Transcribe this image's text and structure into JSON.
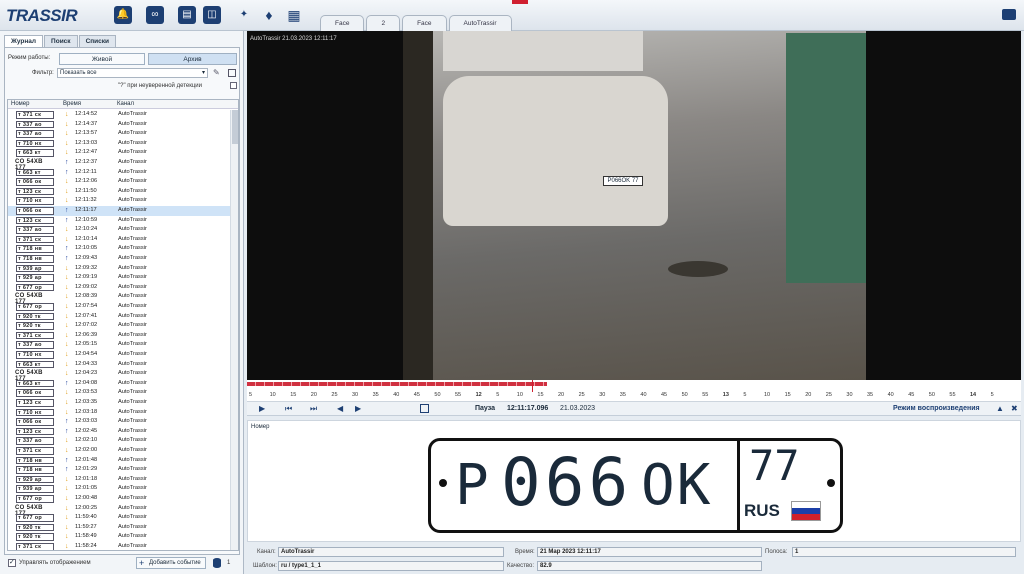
{
  "app": {
    "logo": "TRASSIR"
  },
  "top_tabs": [
    "Face",
    "2",
    "Face",
    "AutoTrassir"
  ],
  "left_panel": {
    "tabs": [
      "Журнал",
      "Поиск",
      "Списки"
    ],
    "mode_label": "Режим работы:",
    "mode_live": "Живой",
    "mode_archive": "Архив",
    "filter_label": "Фильтр:",
    "filter_value": "Показать все",
    "wildcard_label": "\"?\" при неуверенной детекции",
    "columns": [
      "Номер",
      "Время",
      "Канал"
    ],
    "rows": [
      {
        "plate": "т 371 ск",
        "dir": "down",
        "time": "12:14:52",
        "channel": "AutoTrassir"
      },
      {
        "plate": "т 337 ао",
        "dir": "down",
        "time": "12:14:37",
        "channel": "AutoTrassir"
      },
      {
        "plate": "т 337 ао",
        "dir": "down",
        "time": "12:13:57",
        "channel": "AutoTrassir"
      },
      {
        "plate": "т 710 нх",
        "dir": "down",
        "time": "12:13:03",
        "channel": "AutoTrassir"
      },
      {
        "plate": "т 663 кт",
        "dir": "down",
        "time": "12:12:47",
        "channel": "AutoTrassir"
      },
      {
        "plate": "CO 54XB 177",
        "dir": "up",
        "time": "12:12:37",
        "channel": "AutoTrassir",
        "bare": true
      },
      {
        "plate": "т 663 кт",
        "dir": "up",
        "time": "12:12:11",
        "channel": "AutoTrassir"
      },
      {
        "plate": "т 066 ок",
        "dir": "down",
        "time": "12:12:06",
        "channel": "AutoTrassir"
      },
      {
        "plate": "т 123 ск",
        "dir": "down",
        "time": "12:11:50",
        "channel": "AutoTrassir"
      },
      {
        "plate": "т 710 нх",
        "dir": "down",
        "time": "12:11:32",
        "channel": "AutoTrassir"
      },
      {
        "plate": "т 066 ок",
        "dir": "up",
        "time": "12:11:17",
        "channel": "AutoTrassir",
        "selected": true
      },
      {
        "plate": "т 123 ск",
        "dir": "up",
        "time": "12:10:59",
        "channel": "AutoTrassir"
      },
      {
        "plate": "т 337 ао",
        "dir": "down",
        "time": "12:10:24",
        "channel": "AutoTrassir"
      },
      {
        "plate": "т 371 ск",
        "dir": "down",
        "time": "12:10:14",
        "channel": "AutoTrassir"
      },
      {
        "plate": "т 718 нв",
        "dir": "up",
        "time": "12:10:05",
        "channel": "AutoTrassir"
      },
      {
        "plate": "т 718 нв",
        "dir": "up",
        "time": "12:09:43",
        "channel": "AutoTrassir"
      },
      {
        "plate": "т 939 ар",
        "dir": "down",
        "time": "12:09:32",
        "channel": "AutoTrassir"
      },
      {
        "plate": "т 929 ар",
        "dir": "down",
        "time": "12:09:19",
        "channel": "AutoTrassir"
      },
      {
        "plate": "т 677 ор",
        "dir": "down",
        "time": "12:09:02",
        "channel": "AutoTrassir"
      },
      {
        "plate": "CO 54XB 177",
        "dir": "down",
        "time": "12:08:39",
        "channel": "AutoTrassir",
        "bare": true
      },
      {
        "plate": "т 677 ор",
        "dir": "down",
        "time": "12:07:54",
        "channel": "AutoTrassir"
      },
      {
        "plate": "т 920 тк",
        "dir": "down",
        "time": "12:07:41",
        "channel": "AutoTrassir"
      },
      {
        "plate": "т 920 тк",
        "dir": "down",
        "time": "12:07:02",
        "channel": "AutoTrassir"
      },
      {
        "plate": "т 371 ск",
        "dir": "down",
        "time": "12:06:39",
        "channel": "AutoTrassir"
      },
      {
        "plate": "т 337 ао",
        "dir": "down",
        "time": "12:05:15",
        "channel": "AutoTrassir"
      },
      {
        "plate": "т 710 нх",
        "dir": "down",
        "time": "12:04:54",
        "channel": "AutoTrassir"
      },
      {
        "plate": "т 663 кт",
        "dir": "down",
        "time": "12:04:33",
        "channel": "AutoTrassir"
      },
      {
        "plate": "CO 54XB 177",
        "dir": "down",
        "time": "12:04:23",
        "channel": "AutoTrassir",
        "bare": true
      },
      {
        "plate": "т 663 кт",
        "dir": "up",
        "time": "12:04:08",
        "channel": "AutoTrassir"
      },
      {
        "plate": "т 066 ок",
        "dir": "down",
        "time": "12:03:53",
        "channel": "AutoTrassir"
      },
      {
        "plate": "т 123 ск",
        "dir": "down",
        "time": "12:03:35",
        "channel": "AutoTrassir"
      },
      {
        "plate": "т 710 нх",
        "dir": "down",
        "time": "12:03:18",
        "channel": "AutoTrassir"
      },
      {
        "plate": "т 066 ок",
        "dir": "up",
        "time": "12:03:03",
        "channel": "AutoTrassir"
      },
      {
        "plate": "т 123 ск",
        "dir": "up",
        "time": "12:02:45",
        "channel": "AutoTrassir"
      },
      {
        "plate": "т 337 ао",
        "dir": "down",
        "time": "12:02:10",
        "channel": "AutoTrassir"
      },
      {
        "plate": "т 371 ск",
        "dir": "down",
        "time": "12:02:00",
        "channel": "AutoTrassir"
      },
      {
        "plate": "т 718 нв",
        "dir": "up",
        "time": "12:01:48",
        "channel": "AutoTrassir"
      },
      {
        "plate": "т 718 нв",
        "dir": "up",
        "time": "12:01:29",
        "channel": "AutoTrassir"
      },
      {
        "plate": "т 929 ар",
        "dir": "down",
        "time": "12:01:18",
        "channel": "AutoTrassir"
      },
      {
        "plate": "т 939 ар",
        "dir": "down",
        "time": "12:01:05",
        "channel": "AutoTrassir"
      },
      {
        "plate": "т 677 ор",
        "dir": "down",
        "time": "12:00:48",
        "channel": "AutoTrassir"
      },
      {
        "plate": "CO 54XB 177",
        "dir": "down",
        "time": "12:00:25",
        "channel": "AutoTrassir",
        "bare": true
      },
      {
        "plate": "т 677 ор",
        "dir": "down",
        "time": "11:59:40",
        "channel": "AutoTrassir"
      },
      {
        "plate": "т 920 тк",
        "dir": "down",
        "time": "11:59:27",
        "channel": "AutoTrassir"
      },
      {
        "plate": "т 920 тк",
        "dir": "down",
        "time": "11:58:49",
        "channel": "AutoTrassir"
      },
      {
        "plate": "т 371 ск",
        "dir": "down",
        "time": "11:58:24",
        "channel": "AutoTrassir"
      }
    ],
    "manage_label": "Управлять отображением",
    "add_event_label": "Добавить событие",
    "count": "1"
  },
  "video": {
    "osd": "AutoTrassir 21.03.2023 12:11:17"
  },
  "timeline": {
    "labels": [
      "5",
      "10",
      "15",
      "20",
      "25",
      "30",
      "35",
      "40",
      "45",
      "50",
      "55",
      "12",
      "5",
      "10",
      "15",
      "20",
      "25",
      "30",
      "35",
      "40",
      "45",
      "50",
      "55",
      "13",
      "5",
      "10",
      "15",
      "20",
      "25",
      "30",
      "35",
      "40",
      "45",
      "50",
      "55",
      "14",
      "5"
    ]
  },
  "playback": {
    "status": "Пауза",
    "time": "12:11:17.096",
    "date": "21.03.2023",
    "mode": "Режим воспроизведения"
  },
  "plate_view": {
    "label": "Номер",
    "series": "P",
    "digits": "066",
    "suffix": "OK",
    "region": "77",
    "country": "RUS"
  },
  "info": {
    "channel_label": "Канал:",
    "channel": "AutoTrassir",
    "time_label": "Время:",
    "time": "21 Мар 2023 12:11:17",
    "lane_label": "Полоса:",
    "lane": "1",
    "template_label": "Шаблон:",
    "template": "ru / type1_1_1",
    "quality_label": "Качество:",
    "quality": "82.9"
  }
}
